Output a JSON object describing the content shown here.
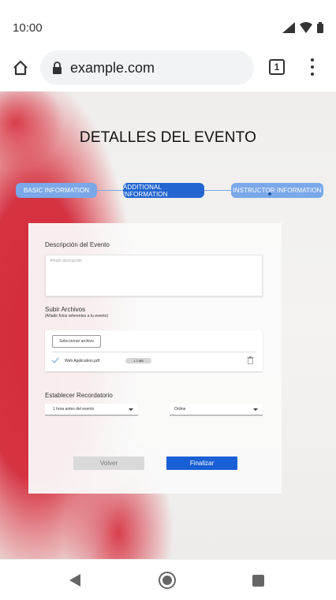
{
  "status_bar": {
    "time": "10:00",
    "icons": [
      "signal-icon",
      "wifi-icon",
      "battery-icon"
    ]
  },
  "browser": {
    "url": "example.com",
    "tab_count": "1",
    "icons": [
      "home-icon",
      "lock-icon",
      "menu-icon"
    ]
  },
  "page": {
    "title": "DETALLES DEL EVENTO"
  },
  "stepper": {
    "steps": [
      {
        "label": "BASIC INFORMATION",
        "state": "inactive"
      },
      {
        "label": "ADDITIONAL INFORMATION",
        "state": "active"
      },
      {
        "label": "INSTRUCTOR INFORMATION",
        "state": "inactive"
      }
    ]
  },
  "form": {
    "description_label": "Descripción del Evento",
    "description_placeholder": "Añadir descripción",
    "upload_label": "Subir Archivos",
    "upload_hint": "(Añadir fotos referentes a tu evento)",
    "select_file_label": "Seleccionar archivo",
    "file": {
      "name": "Web Application.pdf",
      "size": "1.2 MB"
    },
    "reminder_label": "Establecer Recordatorio",
    "reminder_time": "1 hora antes del evento",
    "reminder_mode": "Online",
    "back_label": "Volver",
    "finish_label": "Finalizar"
  },
  "colors": {
    "primary": "#1a5fd6",
    "step_inactive": "#7aa8e8",
    "background_accent": "#d53242"
  }
}
